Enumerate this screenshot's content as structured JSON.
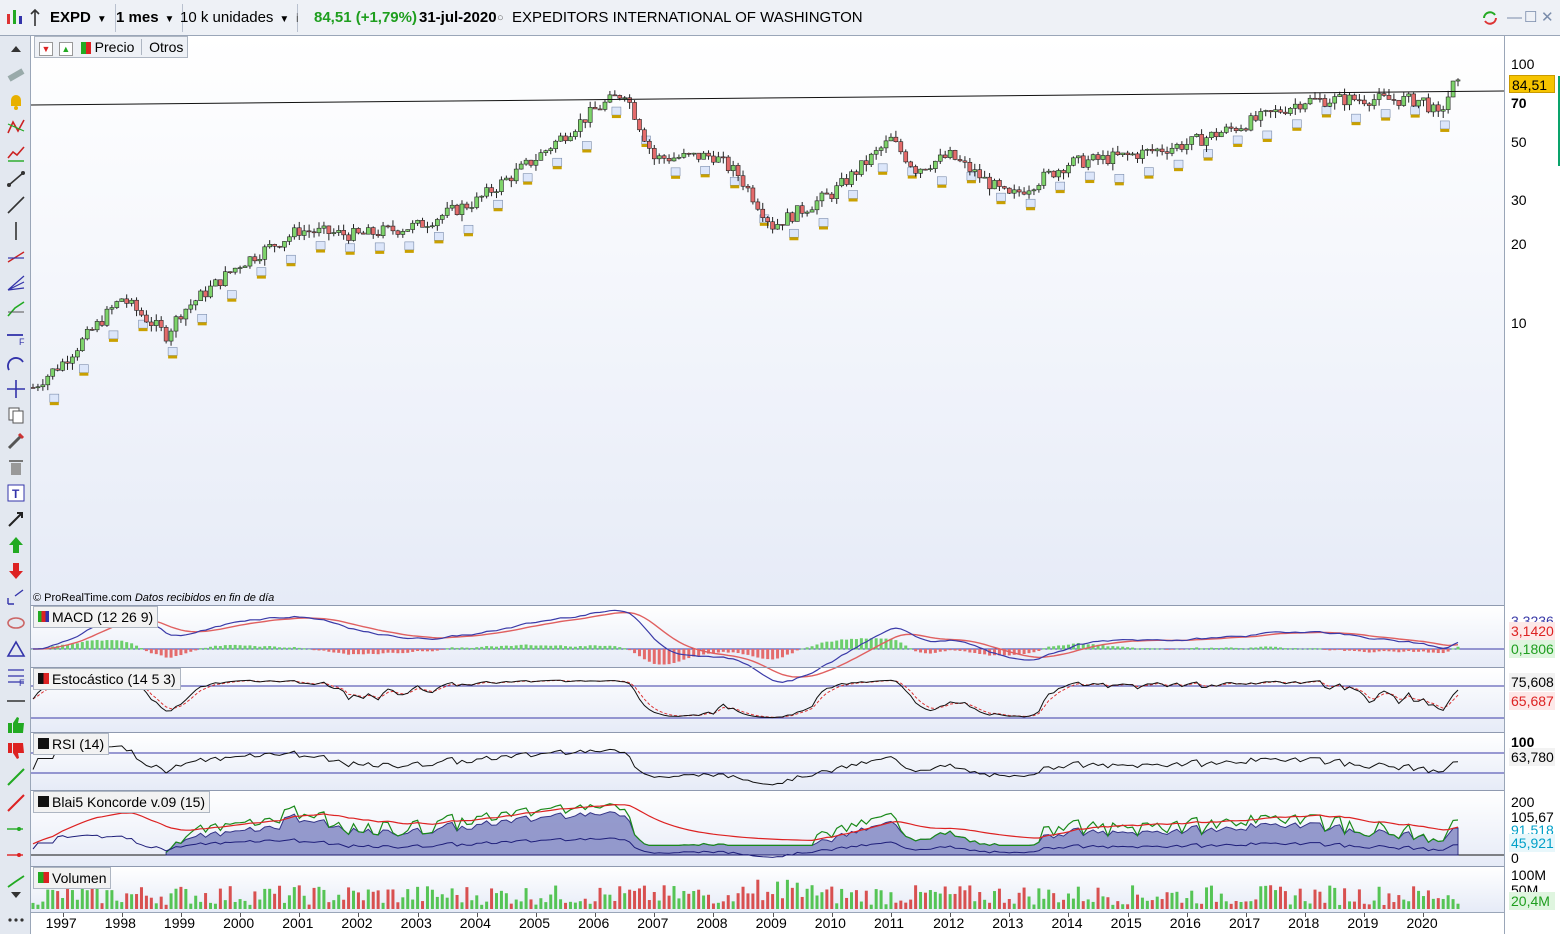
{
  "toolbar": {
    "symbol": "EXPD",
    "period": "1 mes",
    "units": "10 k unidades",
    "quote": "84,51 (+1,79%)",
    "date": "31-jul-2020",
    "company": "EXPEDITORS INTERNATIONAL OF WASHINGTON"
  },
  "price_panel": {
    "tabs": [
      "Precio",
      "Otros"
    ],
    "copyright": "© ProRealTime.com",
    "data_note": "Datos recibidos en fin de día",
    "y_ticks": [
      "100",
      "70",
      "50",
      "30",
      "20",
      "10"
    ],
    "last_price": "84,51"
  },
  "macd_panel": {
    "label": "MACD (12 26 9)",
    "values": [
      "3,3236",
      "3,1420",
      "0,1806"
    ]
  },
  "stoch_panel": {
    "label": "Estocástico (14 5 3)",
    "values": [
      "75,608",
      "65,687"
    ]
  },
  "rsi_panel": {
    "label": "RSI (14)",
    "ticks": [
      "100"
    ],
    "values": [
      "63,780"
    ]
  },
  "koncorde_panel": {
    "label": "Blai5 Koncorde v.09 (15)",
    "ticks": [
      "200",
      "0"
    ],
    "values": [
      "105,67",
      "91,518",
      "45,921"
    ]
  },
  "volume_panel": {
    "label": "Volumen",
    "ticks": [
      "100M",
      "50M"
    ],
    "values": [
      "20,4M"
    ]
  },
  "x_axis": [
    "1997",
    "1998",
    "1999",
    "2000",
    "2001",
    "2002",
    "2003",
    "2004",
    "2005",
    "2006",
    "2007",
    "2008",
    "2009",
    "2010",
    "2011",
    "2012",
    "2013",
    "2014",
    "2015",
    "2016",
    "2017",
    "2018",
    "2019",
    "2020"
  ],
  "colors": {
    "up": "#7ed36b",
    "down": "#e46b6b",
    "macd_line": "#3a3aa8",
    "signal": "#e06060",
    "price_tag": "#f6c400"
  },
  "chart_data": {
    "type": "candlestick",
    "y_scale": "log",
    "ylim": [
      5,
      130
    ],
    "x": [
      "1996-07",
      "1997-01",
      "1998-01",
      "1998-10",
      "1999-01",
      "2000-01",
      "2001-01",
      "2002-01",
      "2003-01",
      "2004-01",
      "2005-01",
      "2006-01",
      "2006-07",
      "2007-01",
      "2008-01",
      "2008-06",
      "2009-01",
      "2010-01",
      "2011-01",
      "2011-06",
      "2012-01",
      "2013-01",
      "2014-01",
      "2015-01",
      "2016-01",
      "2017-01",
      "2018-01",
      "2019-01",
      "2020-01",
      "2020-04",
      "2020-07"
    ],
    "close": [
      5.6,
      7,
      12.5,
      9,
      11,
      17,
      23,
      22,
      24,
      30,
      44,
      68,
      80,
      44,
      45,
      38,
      24,
      32,
      52,
      40,
      45,
      31,
      42,
      45,
      50,
      60,
      74,
      75,
      74,
      64,
      84.51
    ]
  }
}
